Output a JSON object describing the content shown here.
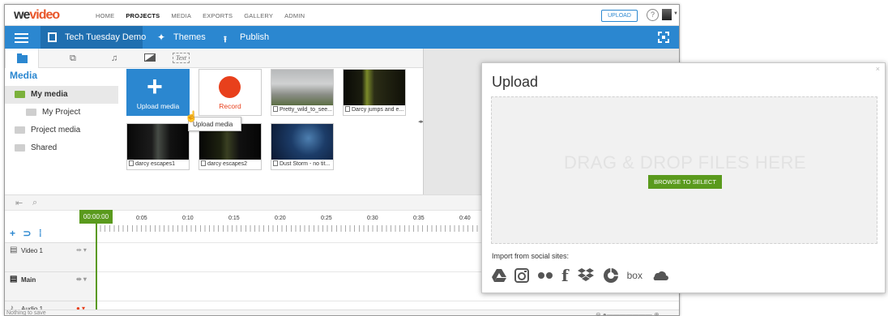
{
  "topnav": {
    "logo_a": "we",
    "logo_b": "video",
    "links": [
      "HOME",
      "PROJECTS",
      "MEDIA",
      "EXPORTS",
      "GALLERY",
      "ADMIN"
    ],
    "upload_label": "UPLOAD",
    "help_glyph": "?"
  },
  "toolbar": {
    "project_title": "Tech Tuesday Demo",
    "themes_label": "Themes",
    "publish_label": "Publish"
  },
  "tabs": {
    "text_label": "Text"
  },
  "sidebar": {
    "heading": "Media",
    "items": [
      {
        "label": "My media"
      },
      {
        "label": "My Project"
      },
      {
        "label": "Project media"
      },
      {
        "label": "Shared"
      }
    ]
  },
  "media": {
    "upload_label": "Upload media",
    "record_label": "Record",
    "tiles": [
      {
        "caption": "Pretty_wild_to_see..."
      },
      {
        "caption": "Darcy jumps and e..."
      },
      {
        "caption": "darcy escapes1"
      },
      {
        "caption": "darcy escapes2"
      },
      {
        "caption": "Dust Storm - no tit..."
      }
    ],
    "tooltip": "Upload media"
  },
  "timeline": {
    "playhead_time": "00:00:00",
    "marks": [
      "0:05",
      "0:10",
      "0:15",
      "0:20",
      "0:25",
      "0:30",
      "0:35",
      "0:40"
    ],
    "tracks": [
      {
        "name": "Video 1"
      },
      {
        "name": "Main"
      },
      {
        "name": "Audio 1"
      }
    ],
    "status": "Nothing to save"
  },
  "modal": {
    "title": "Upload",
    "drop_text": "DRAG & DROP FILES HERE",
    "browse_label": "BROWSE TO SELECT",
    "import_label": "Import from social sites:",
    "box_label": "box"
  },
  "colors": {
    "brand_blue": "#2b87d0",
    "accent_green": "#5a9a1d",
    "record_red": "#e8401c"
  }
}
